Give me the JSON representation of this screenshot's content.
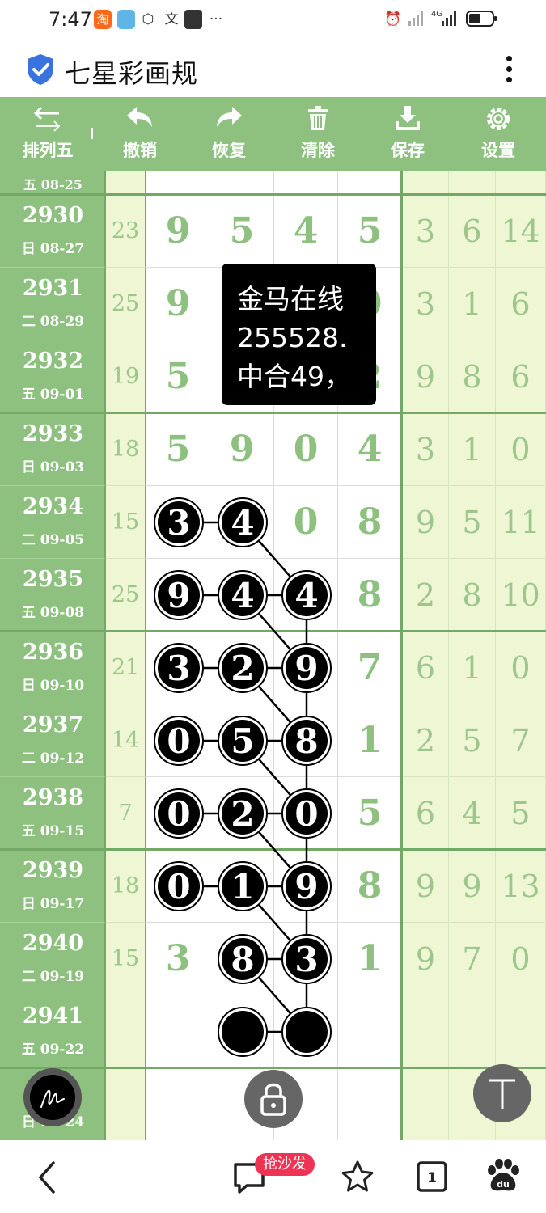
{
  "status_bar": {
    "time": "7:47",
    "left_icons": [
      "taobao-icon",
      "app-icon",
      "settings-hex-icon",
      "translate-icon",
      "image-app-icon",
      "more-dots-icon"
    ],
    "signal_label": "4G",
    "right_icons": [
      "alarm-icon",
      "signal-icon",
      "battery-icon"
    ]
  },
  "app": {
    "title": "七星彩画规",
    "shield_color": "#3a72e0"
  },
  "toolbar": {
    "color": "#8ec080",
    "items": [
      {
        "label": "排列五",
        "icon": "swap-arrows-icon"
      },
      {
        "label": "撤销",
        "icon": "undo-icon"
      },
      {
        "label": "恢复",
        "icon": "redo-icon"
      },
      {
        "label": "清除",
        "icon": "trash-icon"
      },
      {
        "label": "保存",
        "icon": "download-icon"
      },
      {
        "label": "设置",
        "icon": "gear-icon"
      }
    ]
  },
  "partial_top_row": {
    "date": "五 08-25"
  },
  "rows": [
    {
      "issue": "2930",
      "date": "日 08-27",
      "sum": "23",
      "digits": [
        "9",
        "5",
        "4",
        "5"
      ],
      "right": [
        "3",
        "6",
        "14"
      ]
    },
    {
      "issue": "2931",
      "date": "二 08-29",
      "sum": "25",
      "digits": [
        "9",
        "",
        "",
        "0"
      ],
      "right": [
        "3",
        "1",
        "6"
      ]
    },
    {
      "issue": "2932",
      "date": "五 09-01",
      "sum": "19",
      "digits": [
        "5",
        "",
        "",
        "2"
      ],
      "right": [
        "9",
        "8",
        "6"
      ]
    },
    {
      "issue": "2933",
      "date": "日 09-03",
      "sum": "18",
      "digits": [
        "5",
        "9",
        "0",
        "4"
      ],
      "right": [
        "3",
        "1",
        "0"
      ]
    },
    {
      "issue": "2934",
      "date": "二 09-05",
      "sum": "15",
      "digits": [
        "3",
        "4",
        "0",
        "8"
      ],
      "right": [
        "9",
        "5",
        "11"
      ]
    },
    {
      "issue": "2935",
      "date": "五 09-08",
      "sum": "25",
      "digits": [
        "9",
        "4",
        "4",
        "8"
      ],
      "right": [
        "2",
        "8",
        "10"
      ]
    },
    {
      "issue": "2936",
      "date": "日 09-10",
      "sum": "21",
      "digits": [
        "3",
        "2",
        "9",
        "7"
      ],
      "right": [
        "6",
        "1",
        "0"
      ]
    },
    {
      "issue": "2937",
      "date": "二 09-12",
      "sum": "14",
      "digits": [
        "0",
        "5",
        "8",
        "1"
      ],
      "right": [
        "2",
        "5",
        "7"
      ]
    },
    {
      "issue": "2938",
      "date": "五 09-15",
      "sum": "7",
      "digits": [
        "0",
        "2",
        "0",
        "5"
      ],
      "right": [
        "6",
        "4",
        "5"
      ]
    },
    {
      "issue": "2939",
      "date": "日 09-17",
      "sum": "18",
      "digits": [
        "0",
        "1",
        "9",
        "8"
      ],
      "right": [
        "9",
        "9",
        "13"
      ]
    },
    {
      "issue": "2940",
      "date": "二 09-19",
      "sum": "15",
      "digits": [
        "3",
        "8",
        "3",
        "1"
      ],
      "right": [
        "9",
        "7",
        "0"
      ]
    },
    {
      "issue": "2941",
      "date": "五 09-22",
      "sum": "",
      "digits": [
        "",
        "",
        "",
        ""
      ],
      "right": [
        "",
        "",
        ""
      ]
    },
    {
      "issue": "",
      "date": "日 09-24",
      "sum": "",
      "digits": [
        "",
        "",
        "",
        ""
      ],
      "right": [
        "",
        "",
        ""
      ]
    }
  ],
  "marked": [
    {
      "row": 4,
      "cols": [
        0,
        1
      ]
    },
    {
      "row": 5,
      "cols": [
        0,
        1,
        2
      ]
    },
    {
      "row": 6,
      "cols": [
        0,
        1,
        2
      ]
    },
    {
      "row": 7,
      "cols": [
        0,
        1,
        2
      ]
    },
    {
      "row": 8,
      "cols": [
        0,
        1,
        2
      ]
    },
    {
      "row": 9,
      "cols": [
        0,
        1,
        2
      ]
    },
    {
      "row": 10,
      "cols": [
        1,
        2
      ]
    },
    {
      "row": 11,
      "cols": [
        1,
        2
      ]
    }
  ],
  "popup": {
    "lines": [
      "金马在线",
      "255528.",
      "中合49，"
    ]
  },
  "fabs": [
    "pen-icon",
    "lock-icon",
    "scroll-top-icon"
  ],
  "bottom_bar": {
    "badge": "抢沙发",
    "badge_color": "#ee3355",
    "tab_count": "1",
    "icons": [
      "back-icon",
      "comment-icon",
      "star-icon",
      "tabs-icon",
      "baidu-paw-icon"
    ]
  }
}
